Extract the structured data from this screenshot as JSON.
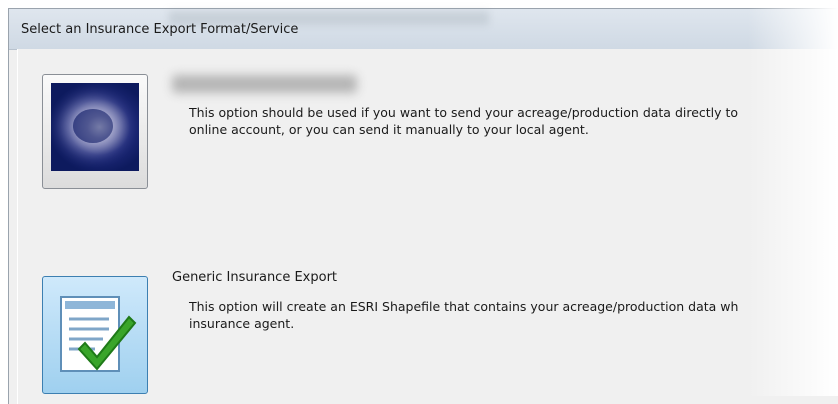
{
  "window": {
    "title": "Select an Insurance Export Format/Service"
  },
  "options": [
    {
      "title": "",
      "title_redacted": true,
      "description_line1": "This option should be used if you want to send your acreage/production data directly to",
      "description_line2": "online account, or you can send it manually to your local agent.",
      "icon": "blurred-logo-icon"
    },
    {
      "title": "Generic Insurance Export",
      "description_line1": "This option will create an ESRI Shapefile that contains your acreage/production data wh",
      "description_line2": "insurance agent.",
      "icon": "document-check-icon",
      "selected": true
    }
  ],
  "colors": {
    "selected_button_bg": "#9fd0ef",
    "checkmark": "#3aa52a",
    "dialog_bg": "#f0f0f0"
  }
}
